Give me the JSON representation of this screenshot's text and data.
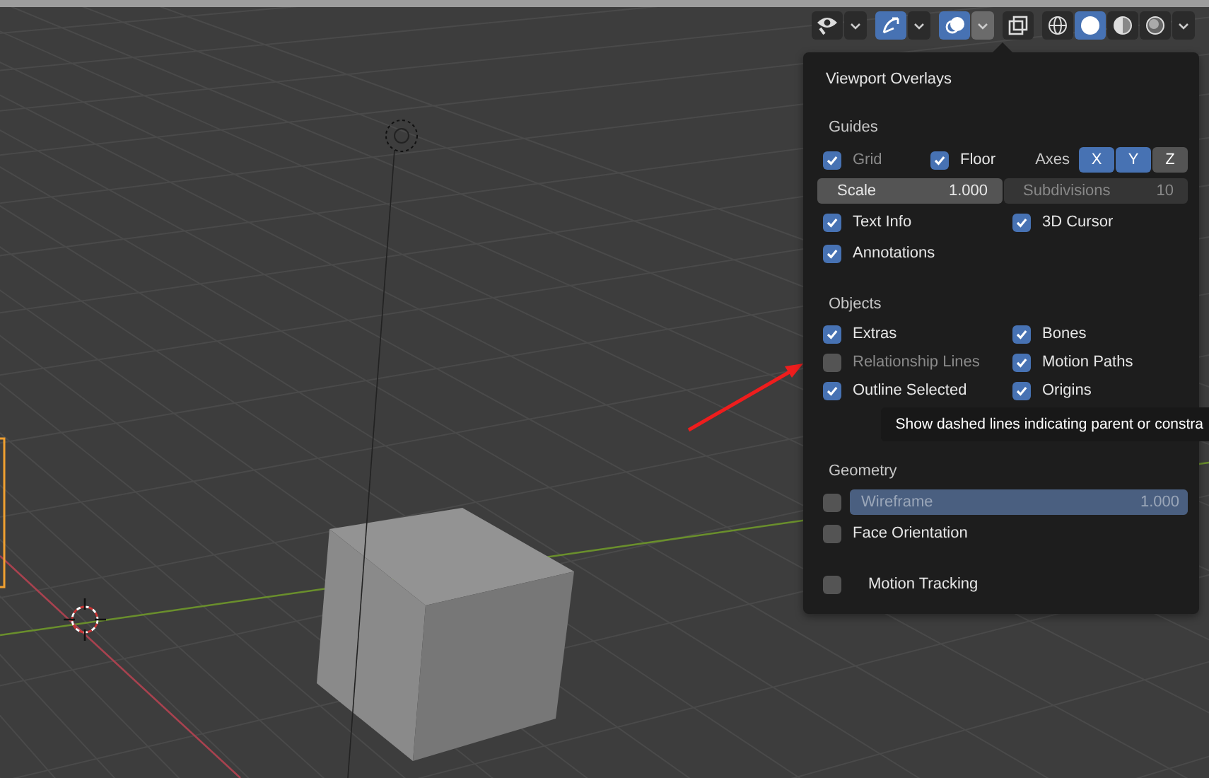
{
  "toolbar": {
    "buttons": [
      {
        "kind": "visibility",
        "selected": false,
        "dropdown": true,
        "open": false
      },
      {
        "kind": "gizmo",
        "selected": true,
        "dropdown": true,
        "open": false
      },
      {
        "kind": "overlays",
        "selected": true,
        "dropdown": true,
        "open": true
      },
      {
        "kind": "xray",
        "selected": false
      }
    ],
    "shading": [
      {
        "kind": "wireframe",
        "selected": false
      },
      {
        "kind": "solid",
        "selected": true
      },
      {
        "kind": "material",
        "selected": false
      },
      {
        "kind": "rendered",
        "selected": false
      }
    ]
  },
  "panel": {
    "title": "Viewport Overlays",
    "sections": [
      {
        "heading": "Guides",
        "rows": [
          {
            "kind": "guides",
            "items": [
              {
                "label": "Grid",
                "checked": true,
                "disabled": true
              },
              {
                "label": "Floor",
                "checked": true,
                "disabled": false
              }
            ],
            "axes_label": "Axes",
            "axes": [
              {
                "label": "X",
                "selected": true
              },
              {
                "label": "Y",
                "selected": true
              },
              {
                "label": "Z",
                "selected": false
              }
            ]
          },
          {
            "kind": "fields",
            "fields": [
              {
                "label": "Scale",
                "value": "1.000",
                "disabled": false
              },
              {
                "label": "Subdivisions",
                "value": "10",
                "disabled": true
              }
            ]
          },
          {
            "kind": "checks",
            "items": [
              {
                "label": "Text Info",
                "checked": true,
                "disabled": false
              },
              {
                "label": "3D Cursor",
                "checked": true,
                "disabled": false
              }
            ]
          },
          {
            "kind": "checks",
            "items": [
              {
                "label": "Annotations",
                "checked": true,
                "disabled": false
              }
            ]
          }
        ]
      },
      {
        "heading": "Objects",
        "rows": [
          {
            "kind": "checks",
            "items": [
              {
                "label": "Extras",
                "checked": true,
                "disabled": false
              },
              {
                "label": "Bones",
                "checked": true,
                "disabled": false
              }
            ]
          },
          {
            "kind": "checks",
            "items": [
              {
                "label": "Relationship Lines",
                "checked": false,
                "disabled": true
              },
              {
                "label": "Motion Paths",
                "checked": true,
                "disabled": false
              }
            ]
          },
          {
            "kind": "checks",
            "items": [
              {
                "label": "Outline Selected",
                "checked": true,
                "disabled": false
              },
              {
                "label": "Origins",
                "checked": true,
                "disabled": false
              }
            ]
          }
        ]
      },
      {
        "heading": "Geometry",
        "rows": [
          {
            "kind": "slider",
            "label": "Wireframe",
            "value": "1.000",
            "checked": false,
            "disabled": true,
            "level": 1
          },
          {
            "kind": "checks",
            "items": [
              {
                "label": "Face Orientation",
                "checked": false,
                "disabled": false
              }
            ]
          }
        ]
      },
      {
        "rows": [
          {
            "kind": "subpanel",
            "items": [
              {
                "label": "Motion Tracking",
                "checked": false,
                "disabled": false
              }
            ]
          }
        ]
      }
    ]
  },
  "tooltip": "Show dashed lines indicating parent or constra"
}
